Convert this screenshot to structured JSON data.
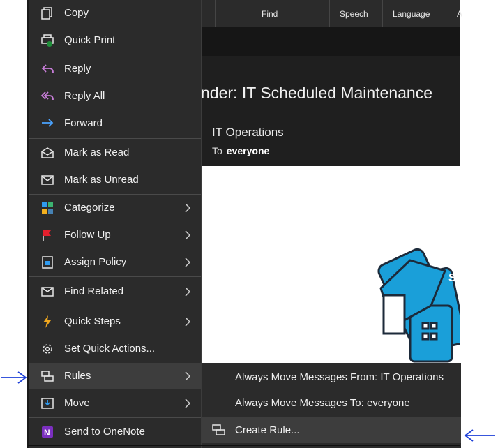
{
  "ribbon": {
    "find_label": "Find",
    "speech_label": "Speech",
    "language_label": "Language",
    "cut_label": "A"
  },
  "message": {
    "subject_partial": "nder: IT Scheduled Maintenance",
    "sender": "IT Operations",
    "to_label": "To",
    "to_value": "everyone",
    "sidebar_tile_text": "Sh"
  },
  "context_menu": {
    "items": [
      {
        "label": "Copy",
        "icon": "copy-icon"
      },
      {
        "label": "Quick Print",
        "icon": "quick-print-icon"
      },
      {
        "label": "Reply",
        "icon": "reply-icon"
      },
      {
        "label": "Reply All",
        "icon": "reply-all-icon"
      },
      {
        "label": "Forward",
        "icon": "forward-icon"
      },
      {
        "label": "Mark as Read",
        "icon": "mark-read-icon"
      },
      {
        "label": "Mark as Unread",
        "icon": "mark-unread-icon"
      },
      {
        "label": "Categorize",
        "icon": "categorize-icon"
      },
      {
        "label": "Follow Up",
        "icon": "flag-icon"
      },
      {
        "label": "Assign Policy",
        "icon": "policy-icon"
      },
      {
        "label": "Find Related",
        "icon": "find-related-icon"
      },
      {
        "label": "Quick Steps",
        "icon": "lightning-icon"
      },
      {
        "label": "Set Quick Actions...",
        "icon": "gear-icon"
      },
      {
        "label": "Rules",
        "icon": "rules-icon"
      },
      {
        "label": "Move",
        "icon": "move-icon"
      },
      {
        "label": "Send to OneNote",
        "icon": "onenote-icon"
      }
    ]
  },
  "rules_submenu": {
    "items": [
      {
        "label": "Always Move Messages From: IT Operations"
      },
      {
        "label": "Always Move Messages To: everyone"
      },
      {
        "label": "Create Rule..."
      }
    ]
  },
  "colors": {
    "menu_bg": "#2b2b2b",
    "highlight": "#3d3d3d",
    "annotation_blue": "#1d3fd8"
  }
}
